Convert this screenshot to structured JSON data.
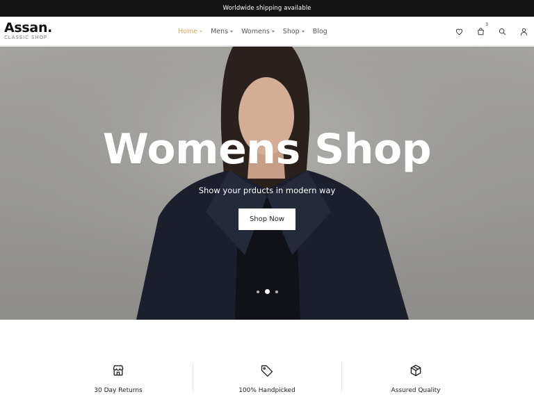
{
  "announcement": "Worldwide shipping available",
  "logo": {
    "name": "Assan.",
    "tagline": "CLASSIC SHOP"
  },
  "nav": [
    {
      "label": "Home",
      "dropdown": true,
      "active": true
    },
    {
      "label": "Mens",
      "dropdown": true
    },
    {
      "label": "Womens",
      "dropdown": true
    },
    {
      "label": "Shop",
      "dropdown": true
    },
    {
      "label": "Blog",
      "dropdown": false
    }
  ],
  "header_icons": {
    "wishlist": "heart-icon",
    "cart": "shopping-bag-icon",
    "cart_count": "3",
    "search": "search-icon",
    "account": "user-icon"
  },
  "hero": {
    "title": "Womens Shop",
    "subtitle": "Show your prducts in modern way",
    "button": "Shop Now",
    "active_slide": 2,
    "slides": 3
  },
  "features": [
    {
      "icon": "store-icon",
      "label": "30 Day Returns"
    },
    {
      "icon": "tag-icon",
      "label": "100% Handpicked"
    },
    {
      "icon": "box-icon",
      "label": "Assured Quality"
    }
  ],
  "colors": {
    "accent": "#d9a35f",
    "topbar": "#141414",
    "coat": "#1b1f2c"
  }
}
